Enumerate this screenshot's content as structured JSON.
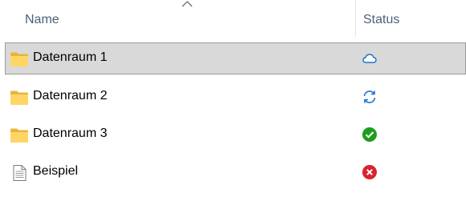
{
  "columns": {
    "name": "Name",
    "status": "Status"
  },
  "rows": [
    {
      "name": "Datenraum 1",
      "type": "folder",
      "status": "cloud-icon",
      "selected": true
    },
    {
      "name": "Datenraum 2",
      "type": "folder",
      "status": "sync-icon",
      "selected": false
    },
    {
      "name": "Datenraum 3",
      "type": "folder",
      "status": "check-icon",
      "selected": false
    },
    {
      "name": "Beispiel",
      "type": "file",
      "status": "error-icon",
      "selected": false
    }
  ],
  "colors": {
    "selection_bg": "#d9d9d9",
    "selection_border": "#999999",
    "cloud": "#1a73c8",
    "sync": "#1a73c8",
    "success": "#1e9e1e",
    "error": "#d9232e"
  }
}
